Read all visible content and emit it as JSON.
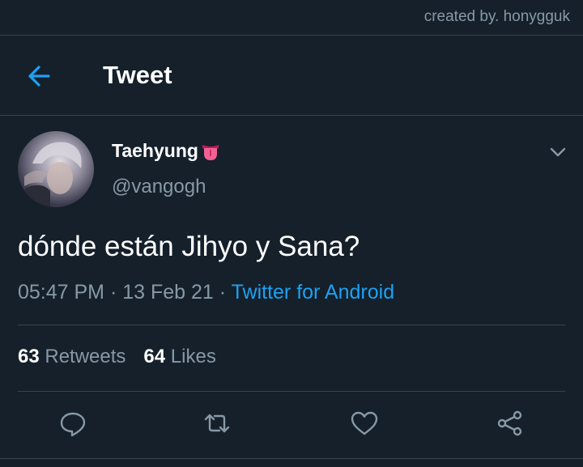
{
  "credit": "created by. honygguk",
  "header": {
    "title": "Tweet"
  },
  "user": {
    "display_name": "Taehyung",
    "handle": "@vangogh",
    "emoji": "tongue-emoji"
  },
  "tweet": {
    "text": "dónde están Jihyo y Sana?",
    "time": "05:47 PM",
    "separator": "·",
    "date": "13 Feb 21",
    "source": "Twitter for Android"
  },
  "stats": {
    "retweets_count": "63",
    "retweets_label": "Retweets",
    "likes_count": "64",
    "likes_label": "Likes"
  },
  "colors": {
    "background": "#15202b",
    "accent": "#1da1f2",
    "muted": "#8899a6",
    "divider": "#38444d"
  },
  "icons": [
    "back-arrow-icon",
    "chevron-down-icon",
    "reply-icon",
    "retweet-icon",
    "like-icon",
    "share-icon"
  ]
}
